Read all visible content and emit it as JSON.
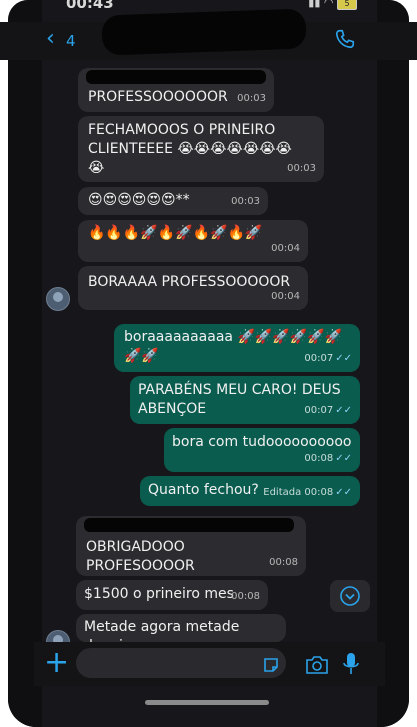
{
  "status_bar": {
    "time": "00:43",
    "battery": "5"
  },
  "header": {
    "back_count": "4"
  },
  "messages": [
    {
      "text": "PROFESSOOOOOOR",
      "time": "00:03"
    },
    {
      "text": "FECHAMOOOS O PRINEIRO\nCLIENTEEEE 😭😭😭😭😭😭😭\n😭",
      "time": "00:03"
    },
    {
      "text": "😍😍😍😍😍😍**",
      "time": "00:03"
    },
    {
      "text": "🔥🔥🔥🚀🔥🚀🔥🚀🔥🚀",
      "time": "00:04"
    },
    {
      "text": "BORAAAA PROFESSOOOOOR",
      "time": "00:04"
    },
    {
      "text": "boraaaaaaaaaa 🚀🚀🚀🚀🚀🚀\n🚀🚀",
      "time": "00:07"
    },
    {
      "text": "PARABÉNS MEU CARO! DEUS\nABENÇOE",
      "time": "00:07"
    },
    {
      "text": "bora com tudoooooooooo",
      "time": "00:08"
    },
    {
      "text": "Quanto fechou?",
      "time": "00:08",
      "edited": "Editada"
    },
    {
      "text": "OBRIGADOOO PROFESOOOOR",
      "time": "00:08"
    },
    {
      "text": "$1500 o prineiro mes",
      "time": "00:08"
    },
    {
      "text": "Metade agora metade depois",
      "time": ""
    }
  ],
  "colors": {
    "accent": "#2ba3ea",
    "outgoing": "#0a5c4f",
    "incoming": "#2c2b2f",
    "read_ticks": "#8fd2f5"
  }
}
